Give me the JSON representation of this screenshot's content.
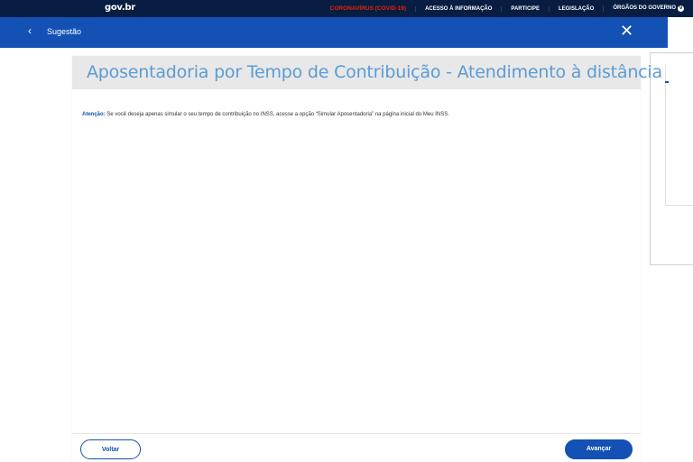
{
  "govbar": {
    "logo": "gov.br",
    "links": [
      {
        "label": "CORONAVÍRUS (COVID-19)"
      },
      {
        "label": "ACESSO À INFORMAÇÃO"
      },
      {
        "label": "PARTICIPE"
      },
      {
        "label": "LEGISLAÇÃO"
      },
      {
        "label": "ÓRGÃOS DO GOVERNO"
      }
    ],
    "chevron": "v"
  },
  "header": {
    "back_icon": "‹",
    "title": "Sugestão",
    "close_icon": "✕"
  },
  "card": {
    "title": "Aposentadoria por Tempo de Contribuição - Atendimento à distância",
    "notice_label": "Atenção:",
    "notice_text": " Se você deseja apenas simular o seu tempo de contribuição no INSS, acesse a opção “Simular Aposentadoria” na página inicial do Meu INSS."
  },
  "buttons": {
    "back": "Voltar",
    "next": "Avançar"
  },
  "colors": {
    "govbar_bg": "#071d41",
    "header_bg": "#1351b4",
    "covid_red": "#e52207",
    "title_blue": "#5b9bd5"
  }
}
